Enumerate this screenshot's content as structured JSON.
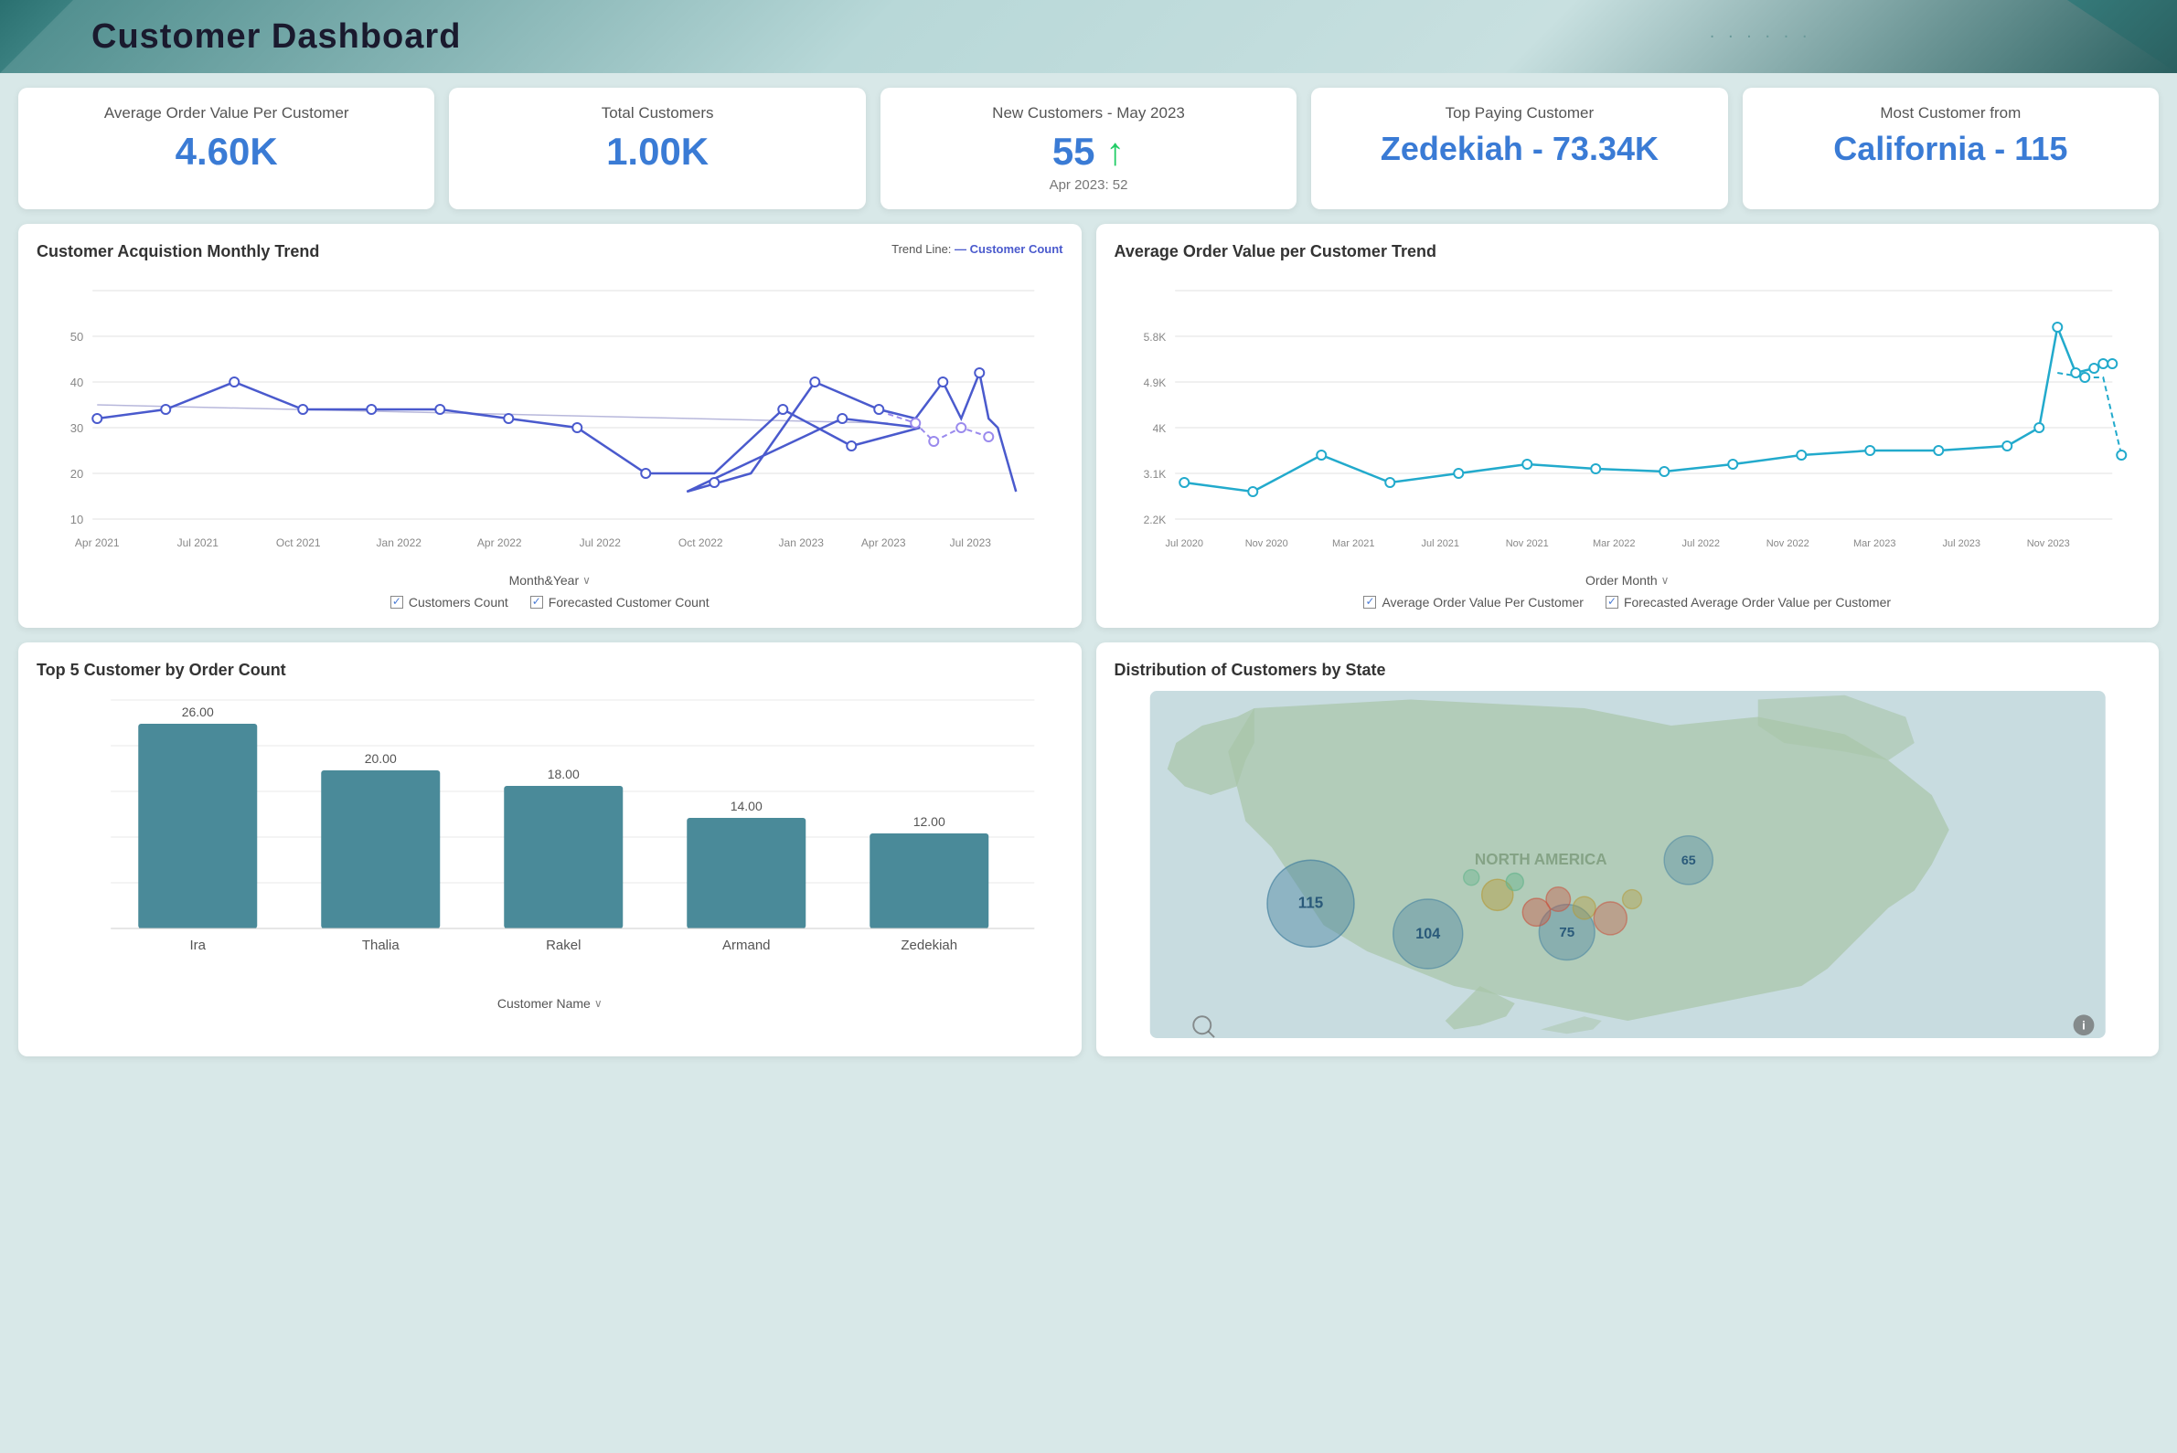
{
  "header": {
    "title": "Customer Dashboard"
  },
  "kpis": [
    {
      "id": "avg-order",
      "label": "Average Order Value Per Customer",
      "value": "4.60K",
      "sub": ""
    },
    {
      "id": "total-customers",
      "label": "Total Customers",
      "value": "1.00K",
      "sub": ""
    },
    {
      "id": "new-customers",
      "label": "New Customers - May 2023",
      "value": "55",
      "trend": "↑",
      "sub": "Apr 2023: 52"
    },
    {
      "id": "top-paying",
      "label": "Top Paying Customer",
      "value": "Zedekiah - 73.34K",
      "sub": ""
    },
    {
      "id": "most-customer",
      "label": "Most Customer from",
      "value": "California - 115",
      "sub": ""
    }
  ],
  "charts": {
    "acquisition": {
      "title": "Customer Acquistion Monthly Trend",
      "trend_label": "Trend Line:",
      "trend_series": "— Customer Count",
      "x_axis_label": "Month&Year",
      "x_labels": [
        "Apr 2021",
        "Jul 2021",
        "Oct 2021",
        "Jan 2022",
        "Apr 2022",
        "Jul 2022",
        "Oct 2022",
        "Jan 2023",
        "Apr 2023",
        "Jul 2023"
      ],
      "y_labels": [
        "10",
        "20",
        "30",
        "40",
        "50"
      ],
      "legend": [
        {
          "label": "Customers Count",
          "color": "#4a5acd"
        },
        {
          "label": "Forecasted Customer Count",
          "color": "#9a8aed"
        }
      ]
    },
    "avg_order_trend": {
      "title": "Average Order Value per Customer Trend",
      "x_axis_label": "Order Month",
      "x_labels": [
        "Jul 2020",
        "Nov 2020",
        "Mar 2021",
        "Jul 2021",
        "Nov 2021",
        "Mar 2022",
        "Jul 2022",
        "Nov 2022",
        "Mar 2023",
        "Jul 2023",
        "Nov 2023"
      ],
      "y_labels": [
        "2.2K",
        "3.1K",
        "4K",
        "4.9K",
        "5.8K"
      ],
      "legend": [
        {
          "label": "Average Order Value Per Customer",
          "color": "#22aacc"
        },
        {
          "label": "Forecasted Average Order Value per Customer",
          "color": "#22aacc"
        }
      ]
    }
  },
  "bar_chart": {
    "title": "Top 5 Customer by Order Count",
    "x_axis_label": "Customer Name",
    "bars": [
      {
        "name": "Ira",
        "value": 26.0,
        "label": "26.00"
      },
      {
        "name": "Thalia",
        "value": 20.0,
        "label": "20.00"
      },
      {
        "name": "Rakel",
        "value": 18.0,
        "label": "18.00"
      },
      {
        "name": "Armand",
        "value": 14.0,
        "label": "14.00"
      },
      {
        "name": "Zedekiah",
        "value": 12.0,
        "label": "12.00"
      }
    ],
    "max_value": 30
  },
  "map": {
    "title": "Distribution of Customers by State",
    "bubbles": [
      {
        "label": "115",
        "x": 18,
        "y": 62,
        "r": 42,
        "color": "rgba(70,130,160,0.6)"
      },
      {
        "label": "104",
        "x": 30,
        "y": 72,
        "r": 36,
        "color": "rgba(70,130,160,0.5)"
      },
      {
        "label": "75",
        "x": 44,
        "y": 72,
        "r": 28,
        "color": "rgba(70,130,160,0.45)"
      },
      {
        "label": "65",
        "x": 52,
        "y": 52,
        "r": 24,
        "color": "rgba(70,130,160,0.4)"
      },
      {
        "label": "",
        "x": 36,
        "y": 62,
        "r": 18,
        "color": "rgba(180,160,80,0.5)"
      },
      {
        "label": "",
        "x": 40,
        "y": 68,
        "r": 14,
        "color": "rgba(200,80,60,0.5)"
      },
      {
        "label": "",
        "x": 43,
        "y": 65,
        "r": 12,
        "color": "rgba(200,80,60,0.4)"
      },
      {
        "label": "",
        "x": 46,
        "y": 63,
        "r": 10,
        "color": "rgba(180,160,80,0.4)"
      },
      {
        "label": "",
        "x": 48,
        "y": 70,
        "r": 16,
        "color": "rgba(200,80,60,0.35)"
      },
      {
        "label": "",
        "x": 25,
        "y": 58,
        "r": 10,
        "color": "rgba(100,180,160,0.5)"
      },
      {
        "label": "",
        "x": 32,
        "y": 55,
        "r": 8,
        "color": "rgba(100,180,160,0.4)"
      },
      {
        "label": "",
        "x": 38,
        "y": 56,
        "r": 12,
        "color": "rgba(180,160,80,0.35)"
      }
    ]
  },
  "colors": {
    "accent_blue": "#3a7bd5",
    "teal": "#4a8a99",
    "header_bg": "#b8d8d8",
    "card_bg": "#ffffff",
    "line1": "#4a5acd",
    "line2": "#22aacc"
  }
}
